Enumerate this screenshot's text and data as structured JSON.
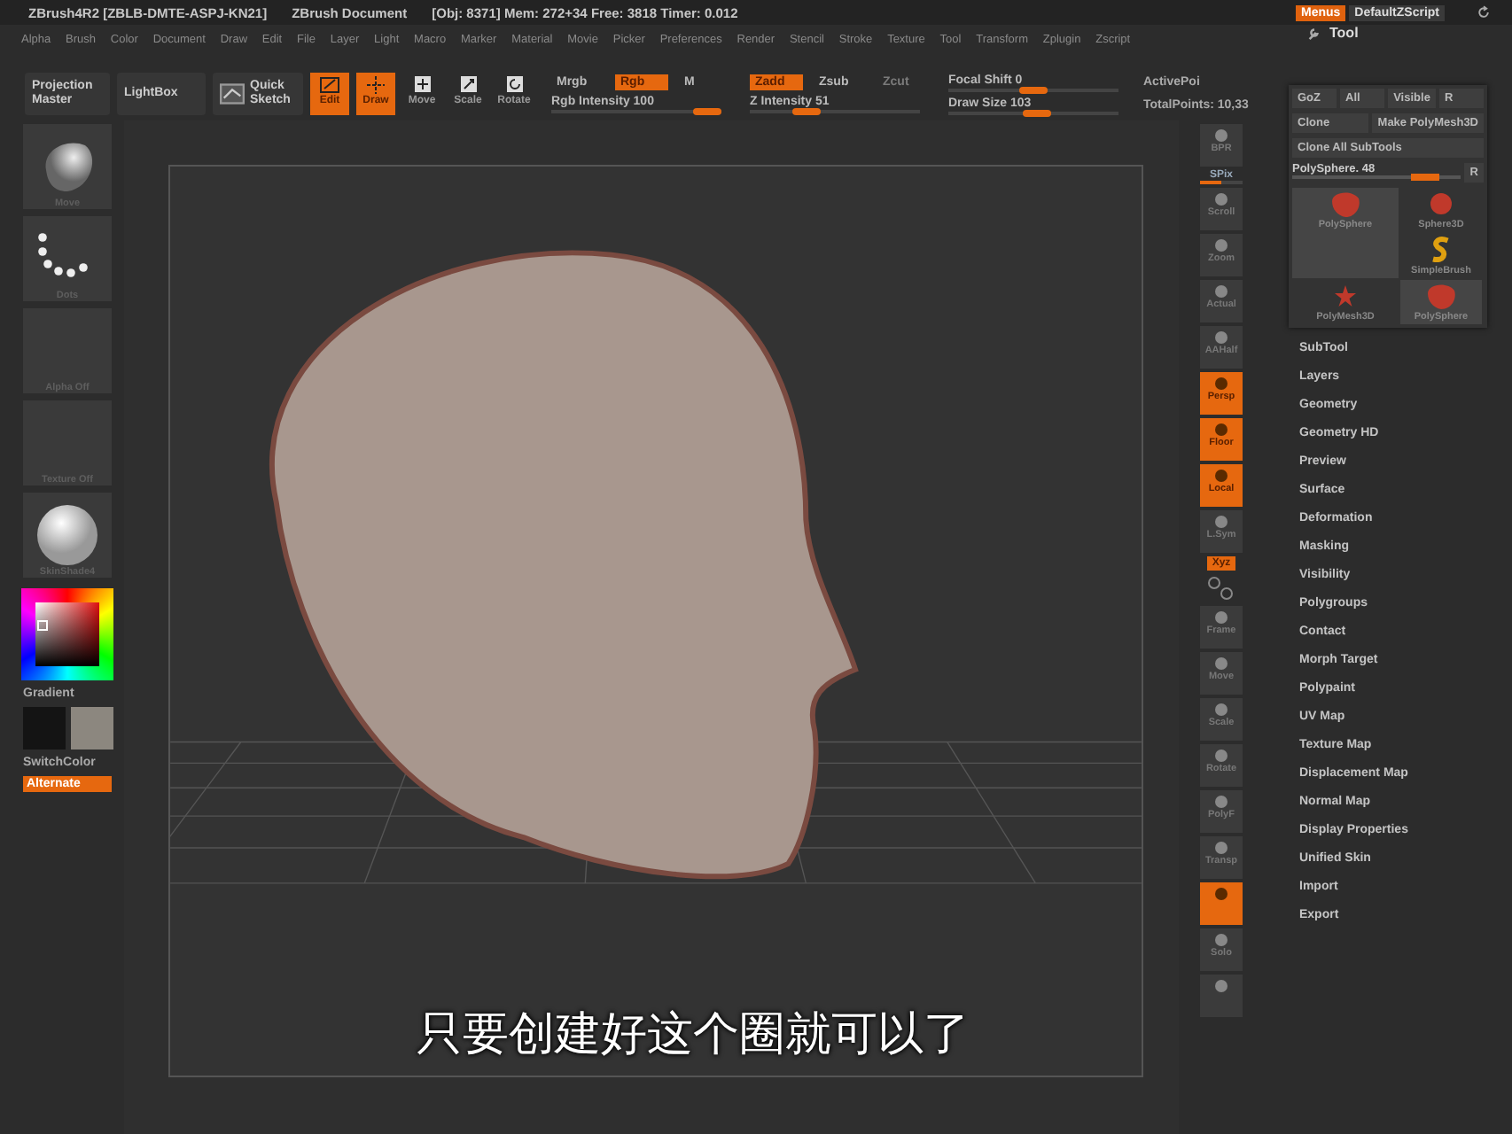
{
  "title_bar": {
    "app": "ZBrush4R2 [ZBLB-DMTE-ASPJ-KN21]",
    "document": "ZBrush Document",
    "stats": "[Obj: 8371] Mem: 272+34 Free: 3818 Timer: 0.012",
    "buttons": [
      {
        "label": "Menus",
        "selected": true
      },
      {
        "label": "DefaultZScript",
        "selected": false
      }
    ]
  },
  "menu_bar": [
    "Alpha",
    "Brush",
    "Color",
    "Document",
    "Draw",
    "Edit",
    "File",
    "Layer",
    "Light",
    "Macro",
    "Marker",
    "Material",
    "Movie",
    "Picker",
    "Preferences",
    "Render",
    "Stencil",
    "Stroke",
    "Texture",
    "Tool",
    "Transform",
    "Zplugin",
    "Zscript"
  ],
  "toolbar": {
    "buttons": [
      {
        "kind": "text",
        "label": "Projection Master"
      },
      {
        "kind": "text",
        "label": "LightBox"
      },
      {
        "kind": "sketch",
        "label": "Quick Sketch"
      }
    ],
    "modes": [
      {
        "kind": "edit",
        "label": "Edit",
        "on": true
      },
      {
        "kind": "draw",
        "label": "Draw",
        "on": true
      },
      {
        "kind": "move",
        "label": "Move",
        "on": false
      },
      {
        "kind": "scale",
        "label": "Scale",
        "on": false
      },
      {
        "kind": "rotate",
        "label": "Rotate",
        "on": false
      }
    ],
    "groups": [
      {
        "toggles": [
          {
            "label": "Mrgb",
            "on": false,
            "disabled": false
          },
          {
            "label": "Rgb",
            "on": true,
            "disabled": false
          },
          {
            "label": "M",
            "on": false,
            "disabled": false
          }
        ],
        "slider": {
          "label": "Rgb Intensity",
          "value": "100",
          "level": 1.0
        }
      },
      {
        "toggles": [
          {
            "label": "Zadd",
            "on": true,
            "disabled": false
          },
          {
            "label": "Zsub",
            "on": false,
            "disabled": false
          },
          {
            "label": "Zcut",
            "on": false,
            "disabled": true
          }
        ],
        "slider": {
          "label": "Z Intensity",
          "value": "51",
          "level": 0.3
        }
      },
      {
        "sliders": [
          {
            "label": "Focal Shift",
            "value": "0",
            "level": 0.5
          },
          {
            "label": "Draw Size",
            "value": "103",
            "level": 0.52
          }
        ]
      }
    ],
    "stats": [
      "ActivePoi",
      "TotalPoints: 10,33"
    ]
  },
  "left_shelf": {
    "thumbs": [
      {
        "kind": "brush",
        "label": "Move"
      },
      {
        "kind": "stroke",
        "label": "Dots"
      },
      {
        "kind": "empty",
        "label": "Alpha Off"
      },
      {
        "kind": "empty",
        "label": "Texture Off"
      },
      {
        "kind": "material",
        "label": "SkinShade4"
      }
    ],
    "gradient_label": "Gradient",
    "swatches": [
      {
        "color": "#141414"
      },
      {
        "color": "#8c877f"
      }
    ],
    "switch_label": "SwitchColor",
    "alternate": {
      "label": "Alternate",
      "on": true
    }
  },
  "right_tools": [
    {
      "kind": "tile",
      "label": "BPR",
      "on": false
    },
    {
      "kind": "slider",
      "label": "SPix",
      "level": 0.5
    },
    {
      "kind": "tile",
      "label": "Scroll",
      "on": false
    },
    {
      "kind": "tile",
      "label": "Zoom",
      "on": false
    },
    {
      "kind": "tile",
      "label": "Actual",
      "on": false
    },
    {
      "kind": "tile",
      "label": "AAHalf",
      "on": false
    },
    {
      "kind": "tile",
      "label": "Persp",
      "on": true
    },
    {
      "kind": "tile",
      "label": "Floor",
      "on": true
    },
    {
      "kind": "tile",
      "label": "Local",
      "on": true
    },
    {
      "kind": "tile",
      "label": "L.Sym",
      "on": false
    },
    {
      "kind": "small",
      "label": "Xyz",
      "on": true
    },
    {
      "kind": "axes"
    },
    {
      "kind": "tile",
      "label": "Frame",
      "on": false
    },
    {
      "kind": "tile",
      "label": "Move",
      "on": false
    },
    {
      "kind": "tile",
      "label": "Scale",
      "on": false
    },
    {
      "kind": "tile",
      "label": "Rotate",
      "on": false
    },
    {
      "kind": "tile",
      "label": "PolyF",
      "on": false
    },
    {
      "kind": "tile",
      "label": "Transp",
      "on": false
    },
    {
      "kind": "tile",
      "on": true
    },
    {
      "kind": "tile",
      "label": "Solo",
      "on": false
    },
    {
      "kind": "tile",
      "on": false
    }
  ],
  "tool_panel": {
    "title": "Tool",
    "goz_row": [
      "GoZ",
      "All",
      "Visible",
      "R"
    ],
    "clone_row": [
      "Clone",
      "Make PolyMesh3D"
    ],
    "clone_all": "Clone All SubTools",
    "slider": {
      "label": "PolySphere. 48",
      "level": 0.85,
      "reset": "R"
    },
    "thumbs": [
      {
        "kind": "head",
        "label": "PolySphere",
        "selected": true
      },
      {
        "kind": "sphere",
        "label": "Sphere3D",
        "selected": false
      },
      {
        "kind": "letter",
        "label": "SimpleBrush",
        "selected": false
      },
      {
        "kind": "star",
        "label": "PolyMesh3D",
        "selected": false
      },
      {
        "kind": "head",
        "label": "PolySphere",
        "selected": true
      }
    ],
    "subpalettes": [
      "SubTool",
      "Layers",
      "Geometry",
      "Geometry HD",
      "Preview",
      "Surface",
      "Deformation",
      "Masking",
      "Visibility",
      "Polygroups",
      "Contact",
      "Morph Target",
      "Polypaint",
      "UV Map",
      "Texture Map",
      "Displacement Map",
      "Normal Map",
      "Display Properties",
      "Unified Skin",
      "Import",
      "Export"
    ]
  },
  "subtitle": "只要创建好这个圈就可以了"
}
